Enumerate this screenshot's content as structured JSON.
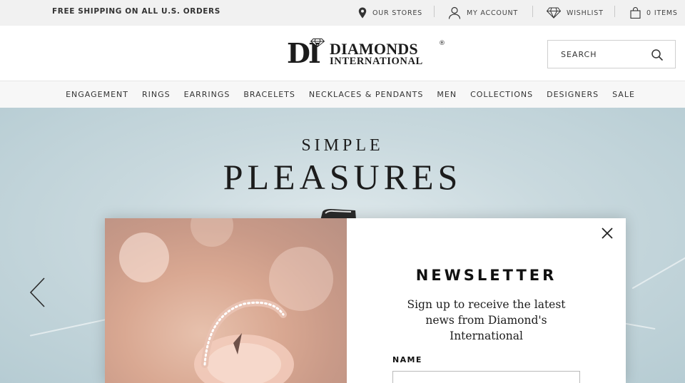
{
  "topbar": {
    "shipping_text": "FREE SHIPPING ON ALL U.S. ORDERS",
    "stores_label": "OUR STORES",
    "account_label": "MY ACCOUNT",
    "wishlist_label": "WISHLIST",
    "cart_count": "0",
    "cart_label": "ITEMS"
  },
  "header": {
    "logo_monogram": "DI",
    "logo_word1": "DIAMONDS",
    "logo_word2": "INTERNATIONAL",
    "logo_reg": "®",
    "search_placeholder": "SEARCH"
  },
  "nav": {
    "items": [
      "ENGAGEMENT",
      "RINGS",
      "EARRINGS",
      "BRACELETS",
      "NECKLACES & PENDANTS",
      "MEN",
      "COLLECTIONS",
      "DESIGNERS",
      "SALE"
    ]
  },
  "hero": {
    "title_line1": "SIMPLE",
    "title_line2": "PLEASURES"
  },
  "modal": {
    "title": "NEWSLETTER",
    "description": "Sign up to receive the latest news from Diamond's International",
    "name_label": "NAME",
    "name_value": ""
  },
  "colors": {
    "topbar_bg": "#f1f1f1",
    "nav_bg": "#f7f7f7",
    "hero_bg": "#c9d9de",
    "text_dark": "#1c1c1c"
  },
  "icons": [
    "map-pin-icon",
    "user-icon",
    "diamond-icon",
    "shopping-bag-icon",
    "search-icon",
    "chevron-left-icon",
    "close-icon"
  ]
}
